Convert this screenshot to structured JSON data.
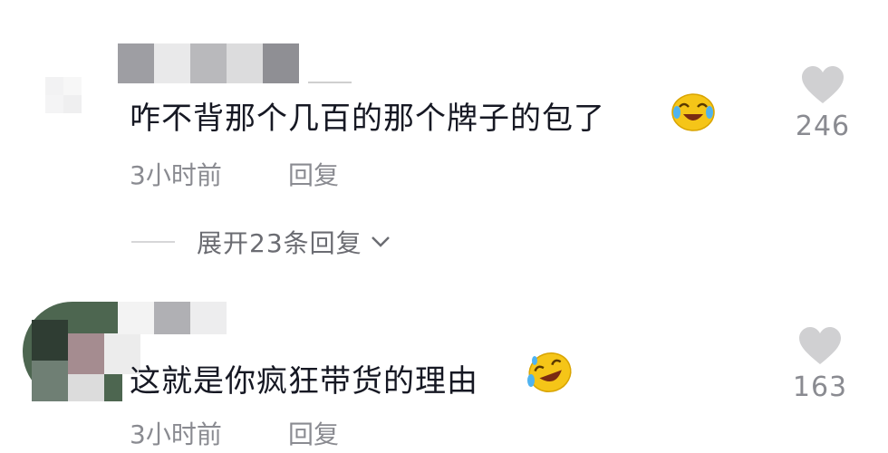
{
  "comments": [
    {
      "text": "咋不背那个几百的那个牌子的包了",
      "time": "3小时前",
      "reply_label": "回复",
      "likes": "246",
      "emoji_icon": "laugh-cry-emoji-icon"
    },
    {
      "text": "这就是你疯狂带货的理由",
      "time": "3小时前",
      "reply_label": "回复",
      "likes": "163",
      "emoji_icon": "rolling-laugh-emoji-icon"
    }
  ],
  "expand_replies": {
    "label": "展开23条回复"
  },
  "colors": {
    "text": "#161823",
    "muted": "#8a8b91",
    "heart": "#d0d0d2",
    "emoji_yellow": "#f5c518"
  }
}
